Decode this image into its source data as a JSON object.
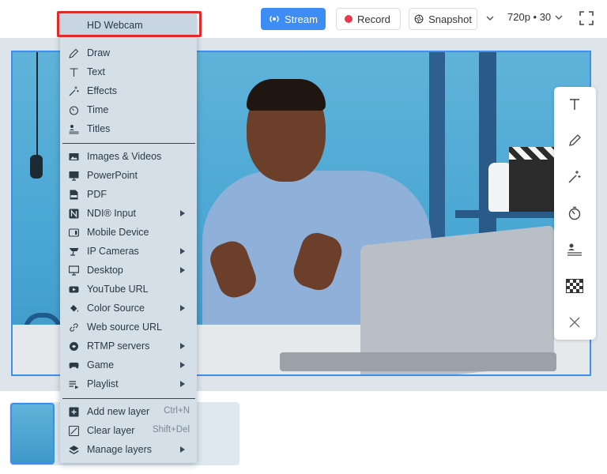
{
  "toolbar": {
    "stream_label": "Stream",
    "record_label": "Record",
    "snapshot_label": "Snapshot",
    "resolution_label": "720p • 30"
  },
  "source_menu": {
    "header": "HD Webcam",
    "group1": [
      {
        "label": "Draw",
        "icon": "pencil-icon"
      },
      {
        "label": "Text",
        "icon": "text-icon"
      },
      {
        "label": "Effects",
        "icon": "magic-wand-icon"
      },
      {
        "label": "Time",
        "icon": "clock-icon"
      },
      {
        "label": "Titles",
        "icon": "titles-icon"
      }
    ],
    "group2": [
      {
        "label": "Images & Videos",
        "icon": "image-icon",
        "submenu": false
      },
      {
        "label": "PowerPoint",
        "icon": "powerpoint-icon",
        "submenu": false
      },
      {
        "label": "PDF",
        "icon": "pdf-icon",
        "submenu": false
      },
      {
        "label": "NDI® Input",
        "icon": "ndi-icon",
        "submenu": true
      },
      {
        "label": "Mobile Device",
        "icon": "mobile-device-icon",
        "submenu": false
      },
      {
        "label": "IP Cameras",
        "icon": "ip-camera-icon",
        "submenu": true
      },
      {
        "label": "Desktop",
        "icon": "desktop-icon",
        "submenu": true
      },
      {
        "label": "YouTube URL",
        "icon": "youtube-icon",
        "submenu": false
      },
      {
        "label": "Color Source",
        "icon": "paint-bucket-icon",
        "submenu": true
      },
      {
        "label": "Web source URL",
        "icon": "link-icon",
        "submenu": false
      },
      {
        "label": "RTMP servers",
        "icon": "rtmp-icon",
        "submenu": true
      },
      {
        "label": "Game",
        "icon": "gamepad-icon",
        "submenu": true
      },
      {
        "label": "Playlist",
        "icon": "playlist-icon",
        "submenu": true
      }
    ],
    "group3": [
      {
        "label": "Add new layer",
        "icon": "add-layer-icon",
        "shortcut": "Ctrl+N",
        "submenu": false
      },
      {
        "label": "Clear layer",
        "icon": "clear-layer-icon",
        "shortcut": "Shift+Del",
        "submenu": false
      },
      {
        "label": "Manage layers",
        "icon": "layers-icon",
        "shortcut": "",
        "submenu": true
      }
    ]
  },
  "right_tools": [
    "text-tool-icon",
    "pencil-tool-icon",
    "effects-tool-icon",
    "timer-tool-icon",
    "titles-tool-icon",
    "checkerboard-tool-icon",
    "close-icon"
  ],
  "colors": {
    "accent": "#3d8df5",
    "record_dot": "#e8394d",
    "highlight_border": "#e02b2b",
    "menu_bg": "#d4dfe8"
  }
}
